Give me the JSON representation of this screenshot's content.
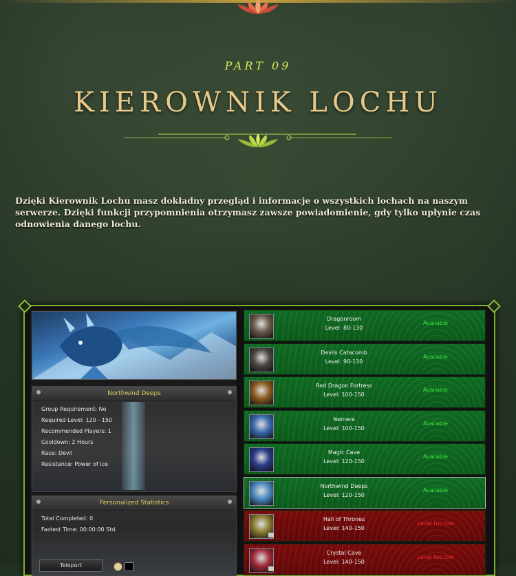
{
  "heading": {
    "part": "PART 09",
    "title": "KIEROWNIK LOCHU"
  },
  "description": "Dzięki Kierownik Lochu masz dokładny przegląd i informacje o wszystkich lochach na naszym serwerze. Dzięki funkcji przypomnienia otrzymasz zawsze powiadomienie, gdy tylko upłynie czas odnowienia danego lochu.",
  "details": {
    "header": "Northwind Deeps",
    "rows": [
      "Group Requirement: No",
      "Required Level: 120 - 150",
      "Recommended Players: 1",
      "Cooldown: 2 Hours",
      "Race: Devil",
      "Resistance: Power of Ice"
    ]
  },
  "stats": {
    "header": "Personalized Statistics",
    "rows": [
      "Total Completed: 0",
      "Fastest Time: 00:00:00 Std."
    ],
    "teleport_label": "Teleport"
  },
  "dungeons": [
    {
      "name": "Dragonroom",
      "level": "Level: 80-130",
      "status": "Available",
      "state": "available",
      "icon": "dragon-icon",
      "color": "#6a5a4a"
    },
    {
      "name": "Devils Catacomb",
      "level": "Level: 90-130",
      "status": "Available",
      "state": "available",
      "icon": "skull-icon",
      "color": "#4a4540"
    },
    {
      "name": "Red Dragon Fortress",
      "level": "Level: 100-150",
      "status": "Available",
      "state": "available",
      "icon": "red-dragon-icon",
      "color": "#8a5a20"
    },
    {
      "name": "Nemere",
      "level": "Level: 100-150",
      "status": "Available",
      "state": "available",
      "icon": "ice-beast-icon",
      "color": "#3a6ab0"
    },
    {
      "name": "Magic Cave",
      "level": "Level: 120-150",
      "status": "Available",
      "state": "available",
      "icon": "mage-icon",
      "color": "#2a3a8a"
    },
    {
      "name": "Northwind Deeps",
      "level": "Level: 120-150",
      "status": "Available",
      "state": "selected",
      "icon": "ice-dragon-icon",
      "color": "#4a8ac0"
    },
    {
      "name": "Hall of Thrones",
      "level": "Level: 140-150",
      "status": "Level too low",
      "state": "locked",
      "icon": "throne-icon",
      "color": "#8a7a30"
    },
    {
      "name": "Crystal Cave",
      "level": "Level: 140-150",
      "status": "Level too low",
      "state": "locked",
      "icon": "crystal-icon",
      "color": "#a02a3a"
    }
  ],
  "colors": {
    "accent": "#d8e85a",
    "title": "#e8c98a",
    "available": "#3fe03f",
    "unavailable": "#ff2a2a",
    "frame": "#7fb230"
  }
}
